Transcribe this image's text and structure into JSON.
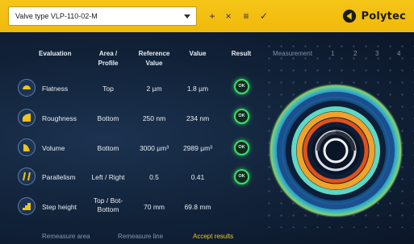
{
  "toolbar": {
    "selected_valve": "Valve type VLP-110-02-M",
    "add_label": "+",
    "remove_label": "×",
    "list_label": "≡",
    "confirm_label": "✓",
    "brand": "Polytec"
  },
  "table": {
    "headers": {
      "evaluation": "Evaluation",
      "area_line1": "Area /",
      "area_line2": "Profile",
      "reference_line1": "Reference",
      "reference_line2": "Value",
      "value": "Value",
      "result": "Result"
    },
    "rows": [
      {
        "name": "Flatness",
        "area": "Top",
        "reference": "2 µm",
        "value": "1.8 µm",
        "result": "OK",
        "icon": "flatness-icon"
      },
      {
        "name": "Roughness",
        "area": "Bottom",
        "reference": "250 nm",
        "value": "234 nm",
        "result": "OK",
        "icon": "roughness-icon"
      },
      {
        "name": "Volume",
        "area": "Bottom",
        "reference": "3000 µm³",
        "value": "2989 µm³",
        "result": "OK",
        "icon": "volume-icon"
      },
      {
        "name": "Parallelism",
        "area": "Left / Right",
        "reference": "0.5",
        "value": "0.41",
        "result": "OK",
        "icon": "parallelism-icon"
      },
      {
        "name": "Step height",
        "area_line1": "Top / Bot-",
        "area_line2": "Bottom",
        "reference": "70 mm",
        "value": "69.8 mm",
        "result": "",
        "icon": "step-height-icon"
      }
    ]
  },
  "measurement": {
    "label": "Measurement",
    "numbers": [
      "1",
      "2",
      "3",
      "4"
    ]
  },
  "footer": {
    "remeasure_area": "Remeasure area",
    "remeasure_line": "Remeasure line",
    "accept_results": "Accept results"
  },
  "colors": {
    "accent": "#f0c419",
    "ok": "#3ddc6c",
    "background": "#0d1a2e"
  }
}
